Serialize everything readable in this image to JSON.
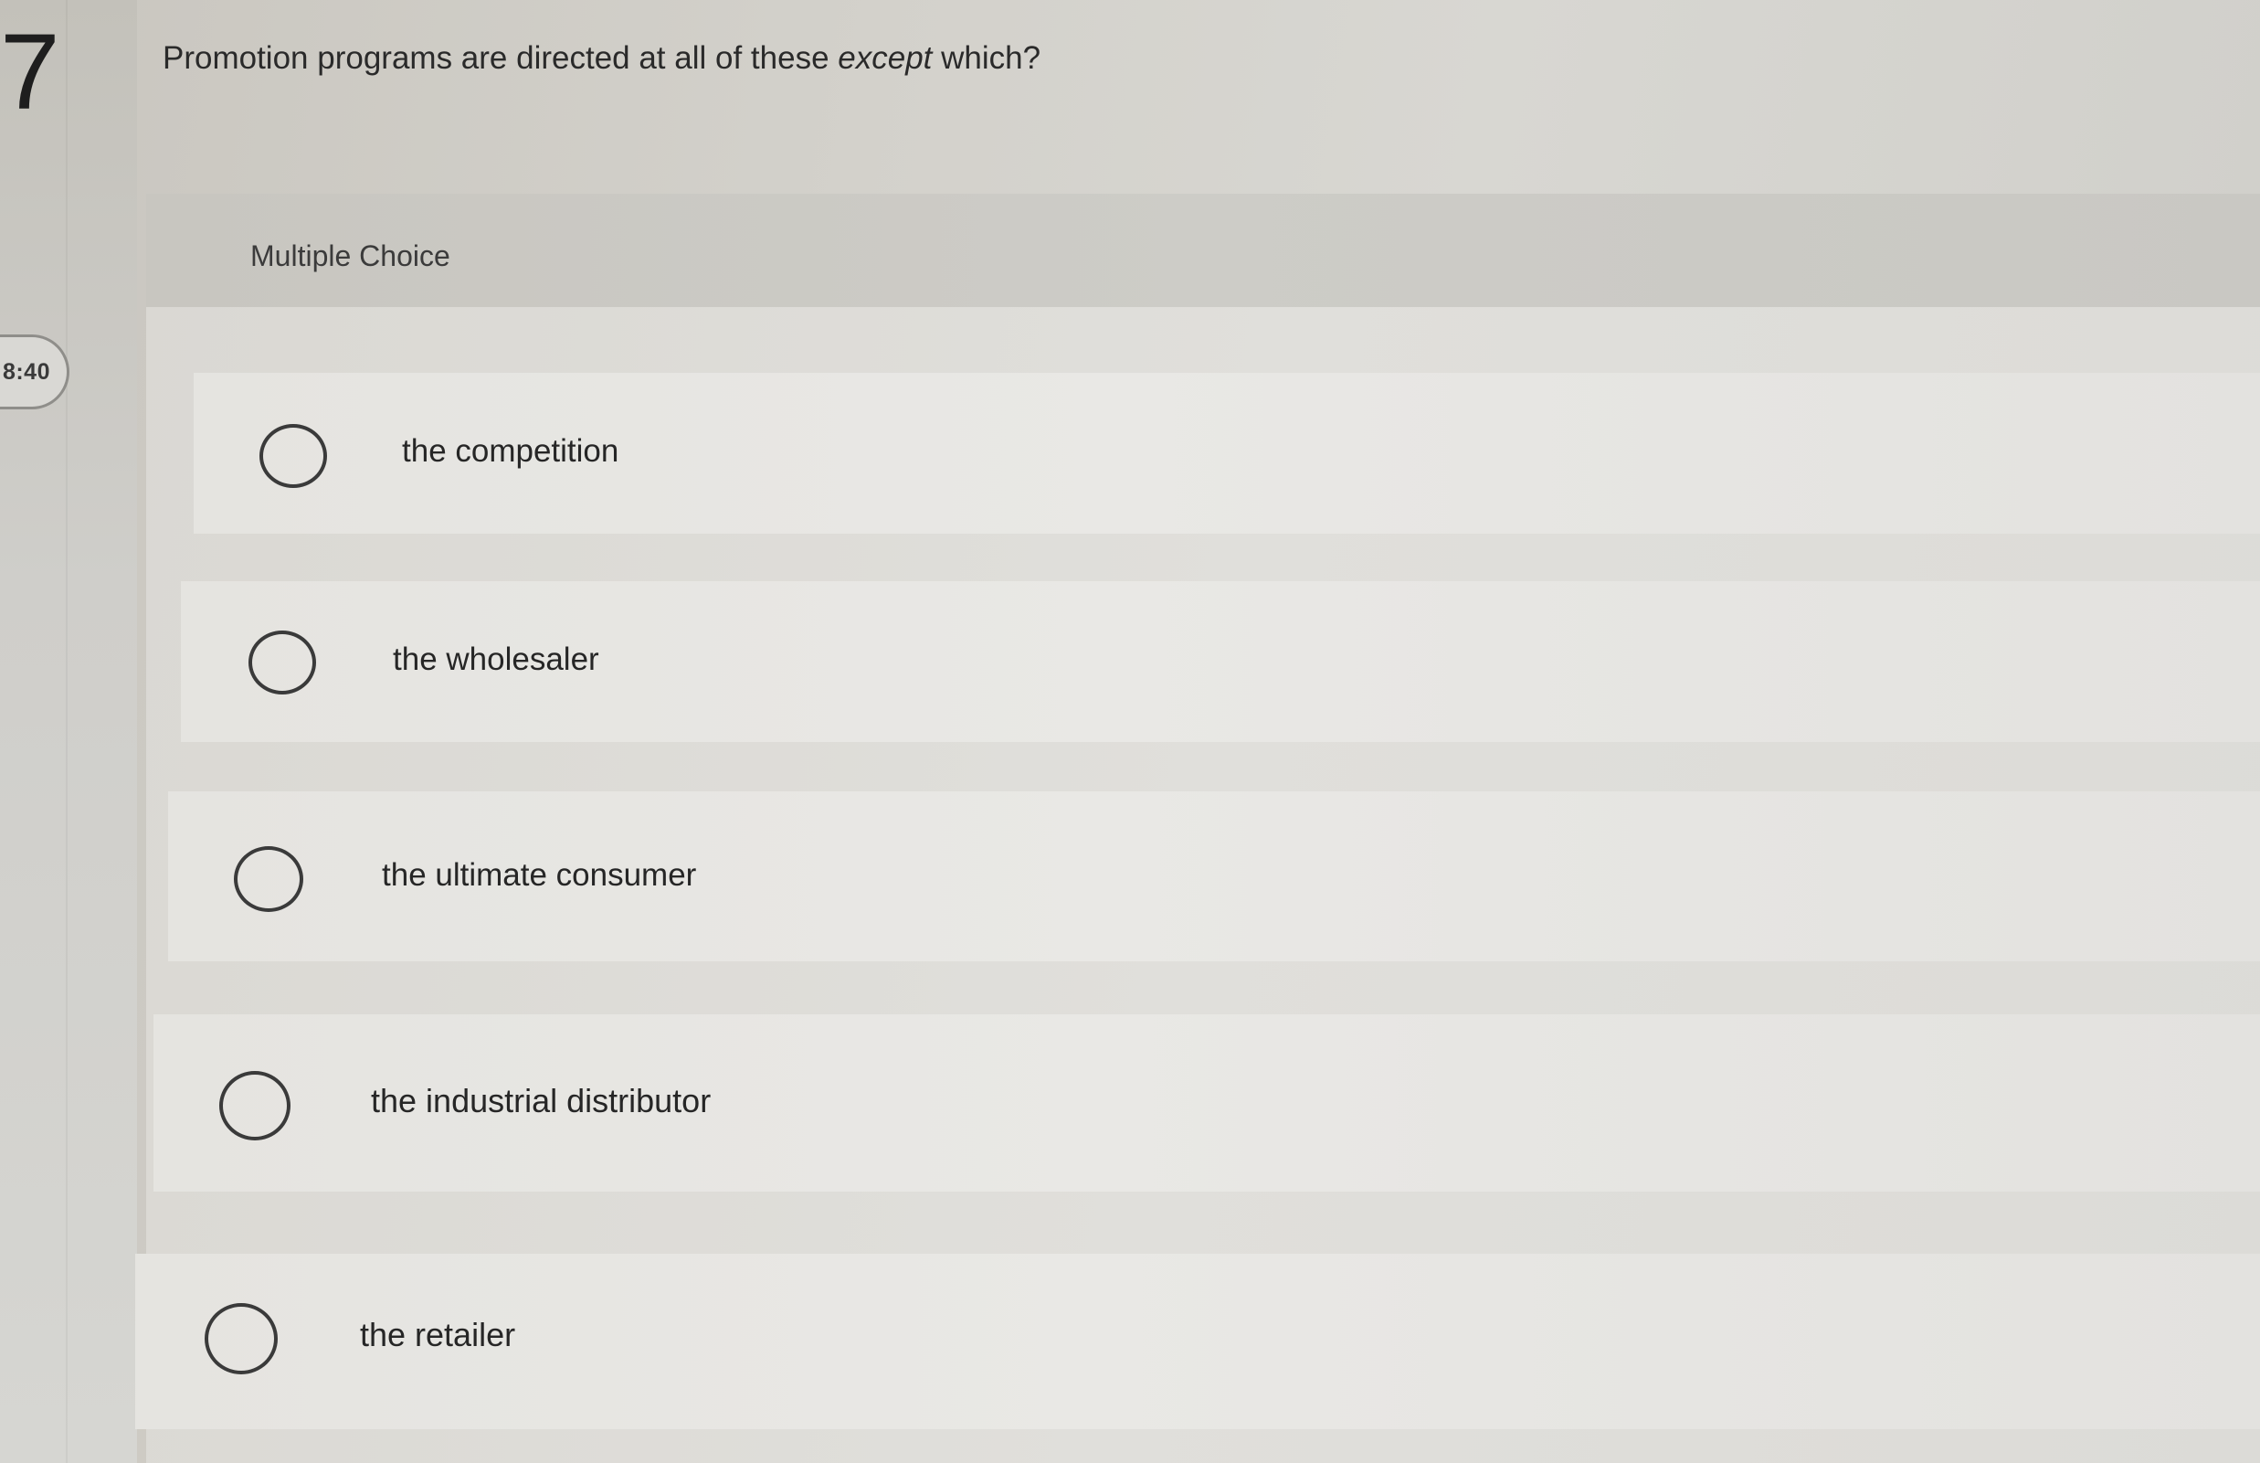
{
  "question": {
    "number": "7",
    "text_before": "Promotion programs are directed at all of these",
    "text_emphasis": "except",
    "text_after": "which?"
  },
  "timer": {
    "value": "8:40"
  },
  "choice_section": {
    "header": "Multiple Choice",
    "options": [
      {
        "label": "the competition",
        "selected": false
      },
      {
        "label": "the wholesaler",
        "selected": false
      },
      {
        "label": "the ultimate consumer",
        "selected": false
      },
      {
        "label": "the industrial distributor",
        "selected": false
      },
      {
        "label": "the retailer",
        "selected": false
      }
    ]
  }
}
